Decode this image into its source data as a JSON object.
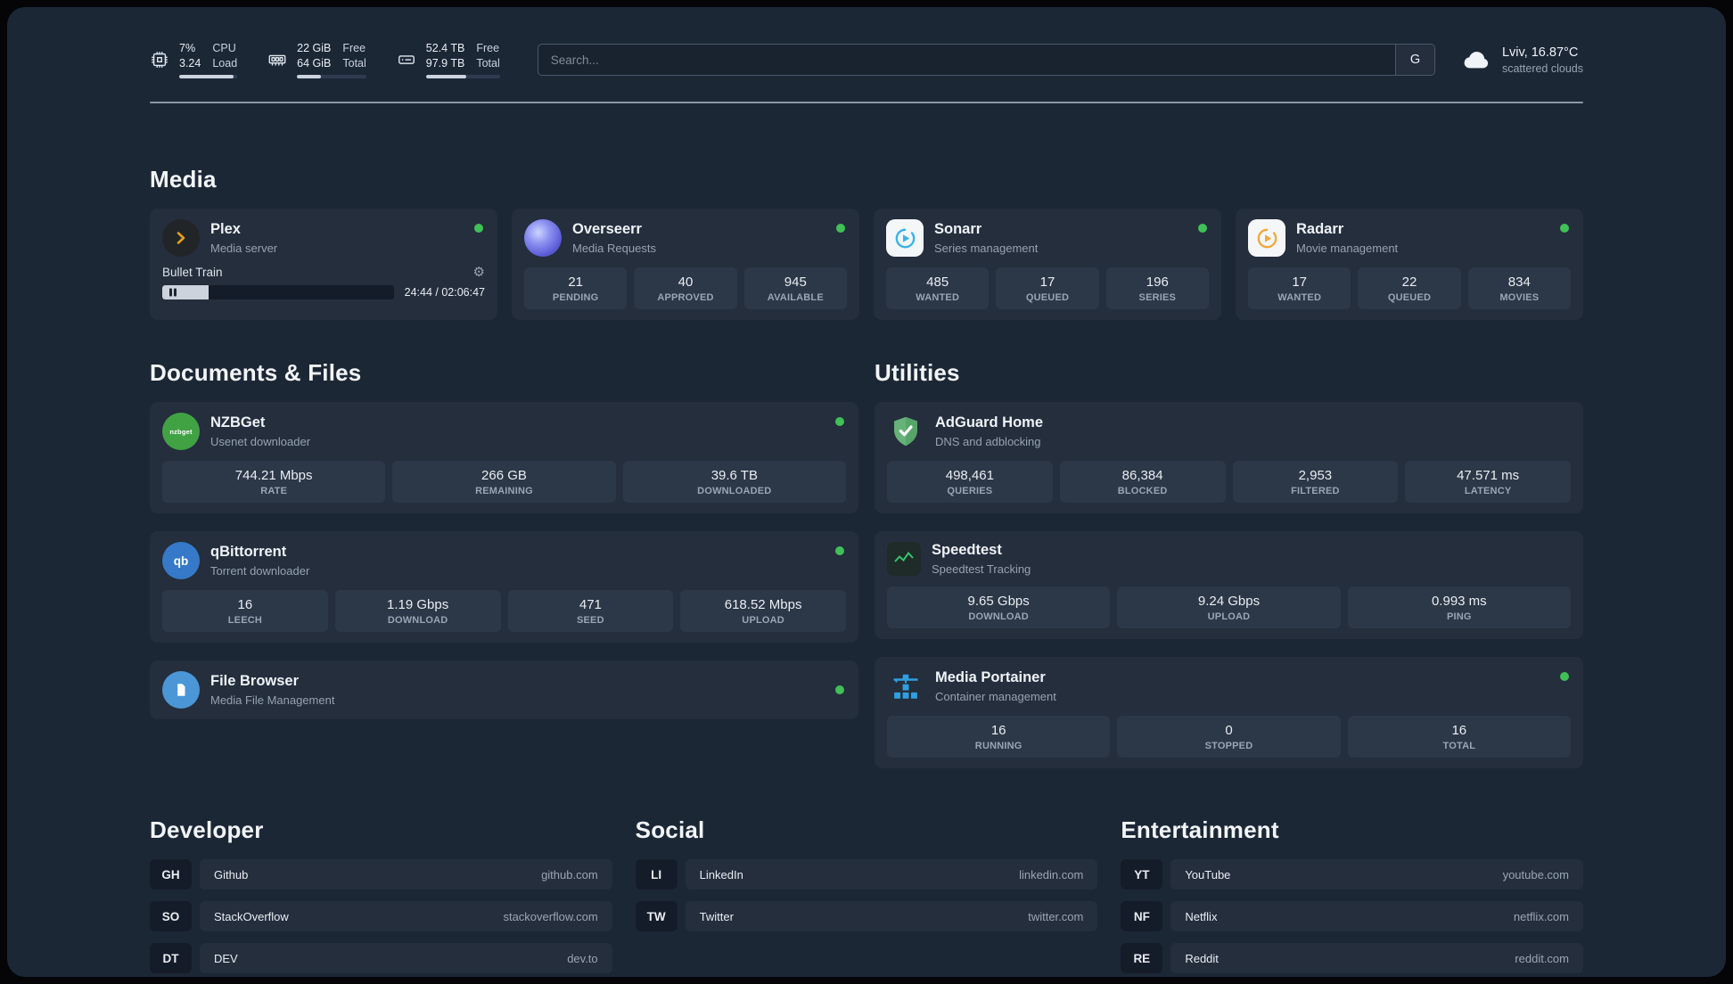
{
  "colors": {
    "status_online": "#40c057",
    "accent_green": "#37c26e"
  },
  "topbar": {
    "cpu": {
      "value_top": "7%",
      "value_bottom": "3.24",
      "label_top": "CPU",
      "label_bottom": "Load",
      "progress": 93
    },
    "ram": {
      "value_top": "22 GiB",
      "value_bottom": "64 GiB",
      "label_top": "Free",
      "label_bottom": "Total",
      "progress": 34
    },
    "disk": {
      "value_top": "52.4 TB",
      "value_bottom": "97.9 TB",
      "label_top": "Free",
      "label_bottom": "Total",
      "progress": 54
    },
    "search": {
      "placeholder": "Search...",
      "engine_button": "G"
    },
    "weather": {
      "location_temp": "Lviv, 16.87°C",
      "condition": "scattered clouds"
    }
  },
  "media": {
    "title": "Media",
    "plex": {
      "name": "Plex",
      "desc": "Media server",
      "now_playing": "Bullet Train",
      "time": "24:44 / 02:06:47",
      "progress": 20
    },
    "overseerr": {
      "name": "Overseerr",
      "desc": "Media Requests",
      "stats": [
        {
          "value": "21",
          "label": "PENDING"
        },
        {
          "value": "40",
          "label": "APPROVED"
        },
        {
          "value": "945",
          "label": "AVAILABLE"
        }
      ]
    },
    "sonarr": {
      "name": "Sonarr",
      "desc": "Series management",
      "stats": [
        {
          "value": "485",
          "label": "WANTED"
        },
        {
          "value": "17",
          "label": "QUEUED"
        },
        {
          "value": "196",
          "label": "SERIES"
        }
      ]
    },
    "radarr": {
      "name": "Radarr",
      "desc": "Movie management",
      "stats": [
        {
          "value": "17",
          "label": "WANTED"
        },
        {
          "value": "22",
          "label": "QUEUED"
        },
        {
          "value": "834",
          "label": "MOVIES"
        }
      ]
    }
  },
  "documents": {
    "title": "Documents & Files",
    "nzbget": {
      "name": "NZBGet",
      "desc": "Usenet downloader",
      "icon_text": "nzbget",
      "stats": [
        {
          "value": "744.21 Mbps",
          "label": "RATE"
        },
        {
          "value": "266 GB",
          "label": "REMAINING"
        },
        {
          "value": "39.6 TB",
          "label": "DOWNLOADED"
        }
      ]
    },
    "qbittorrent": {
      "name": "qBittorrent",
      "desc": "Torrent downloader",
      "icon_text": "qb",
      "stats": [
        {
          "value": "16",
          "label": "LEECH"
        },
        {
          "value": "1.19 Gbps",
          "label": "DOWNLOAD"
        },
        {
          "value": "471",
          "label": "SEED"
        },
        {
          "value": "618.52 Mbps",
          "label": "UPLOAD"
        }
      ]
    },
    "filebrowser": {
      "name": "File Browser",
      "desc": "Media File Management"
    }
  },
  "utilities": {
    "title": "Utilities",
    "adguard": {
      "name": "AdGuard Home",
      "desc": "DNS and adblocking",
      "stats": [
        {
          "value": "498,461",
          "label": "QUERIES"
        },
        {
          "value": "86,384",
          "label": "BLOCKED"
        },
        {
          "value": "2,953",
          "label": "FILTERED"
        },
        {
          "value": "47.571 ms",
          "label": "LATENCY"
        }
      ]
    },
    "speedtest": {
      "name": "Speedtest",
      "desc": "Speedtest Tracking",
      "stats": [
        {
          "value": "9.65 Gbps",
          "label": "DOWNLOAD"
        },
        {
          "value": "9.24 Gbps",
          "label": "UPLOAD"
        },
        {
          "value": "0.993 ms",
          "label": "PING"
        }
      ]
    },
    "portainer": {
      "name": "Media Portainer",
      "desc": "Container management",
      "stats": [
        {
          "value": "16",
          "label": "RUNNING"
        },
        {
          "value": "0",
          "label": "STOPPED"
        },
        {
          "value": "16",
          "label": "TOTAL"
        }
      ]
    }
  },
  "bookmarks": {
    "developer": {
      "title": "Developer",
      "items": [
        {
          "abbr": "GH",
          "name": "Github",
          "url": "github.com"
        },
        {
          "abbr": "SO",
          "name": "StackOverflow",
          "url": "stackoverflow.com"
        },
        {
          "abbr": "DT",
          "name": "DEV",
          "url": "dev.to"
        }
      ]
    },
    "social": {
      "title": "Social",
      "items": [
        {
          "abbr": "LI",
          "name": "LinkedIn",
          "url": "linkedin.com"
        },
        {
          "abbr": "TW",
          "name": "Twitter",
          "url": "twitter.com"
        }
      ]
    },
    "entertainment": {
      "title": "Entertainment",
      "items": [
        {
          "abbr": "YT",
          "name": "YouTube",
          "url": "youtube.com"
        },
        {
          "abbr": "NF",
          "name": "Netflix",
          "url": "netflix.com"
        },
        {
          "abbr": "RE",
          "name": "Reddit",
          "url": "reddit.com"
        }
      ]
    }
  }
}
